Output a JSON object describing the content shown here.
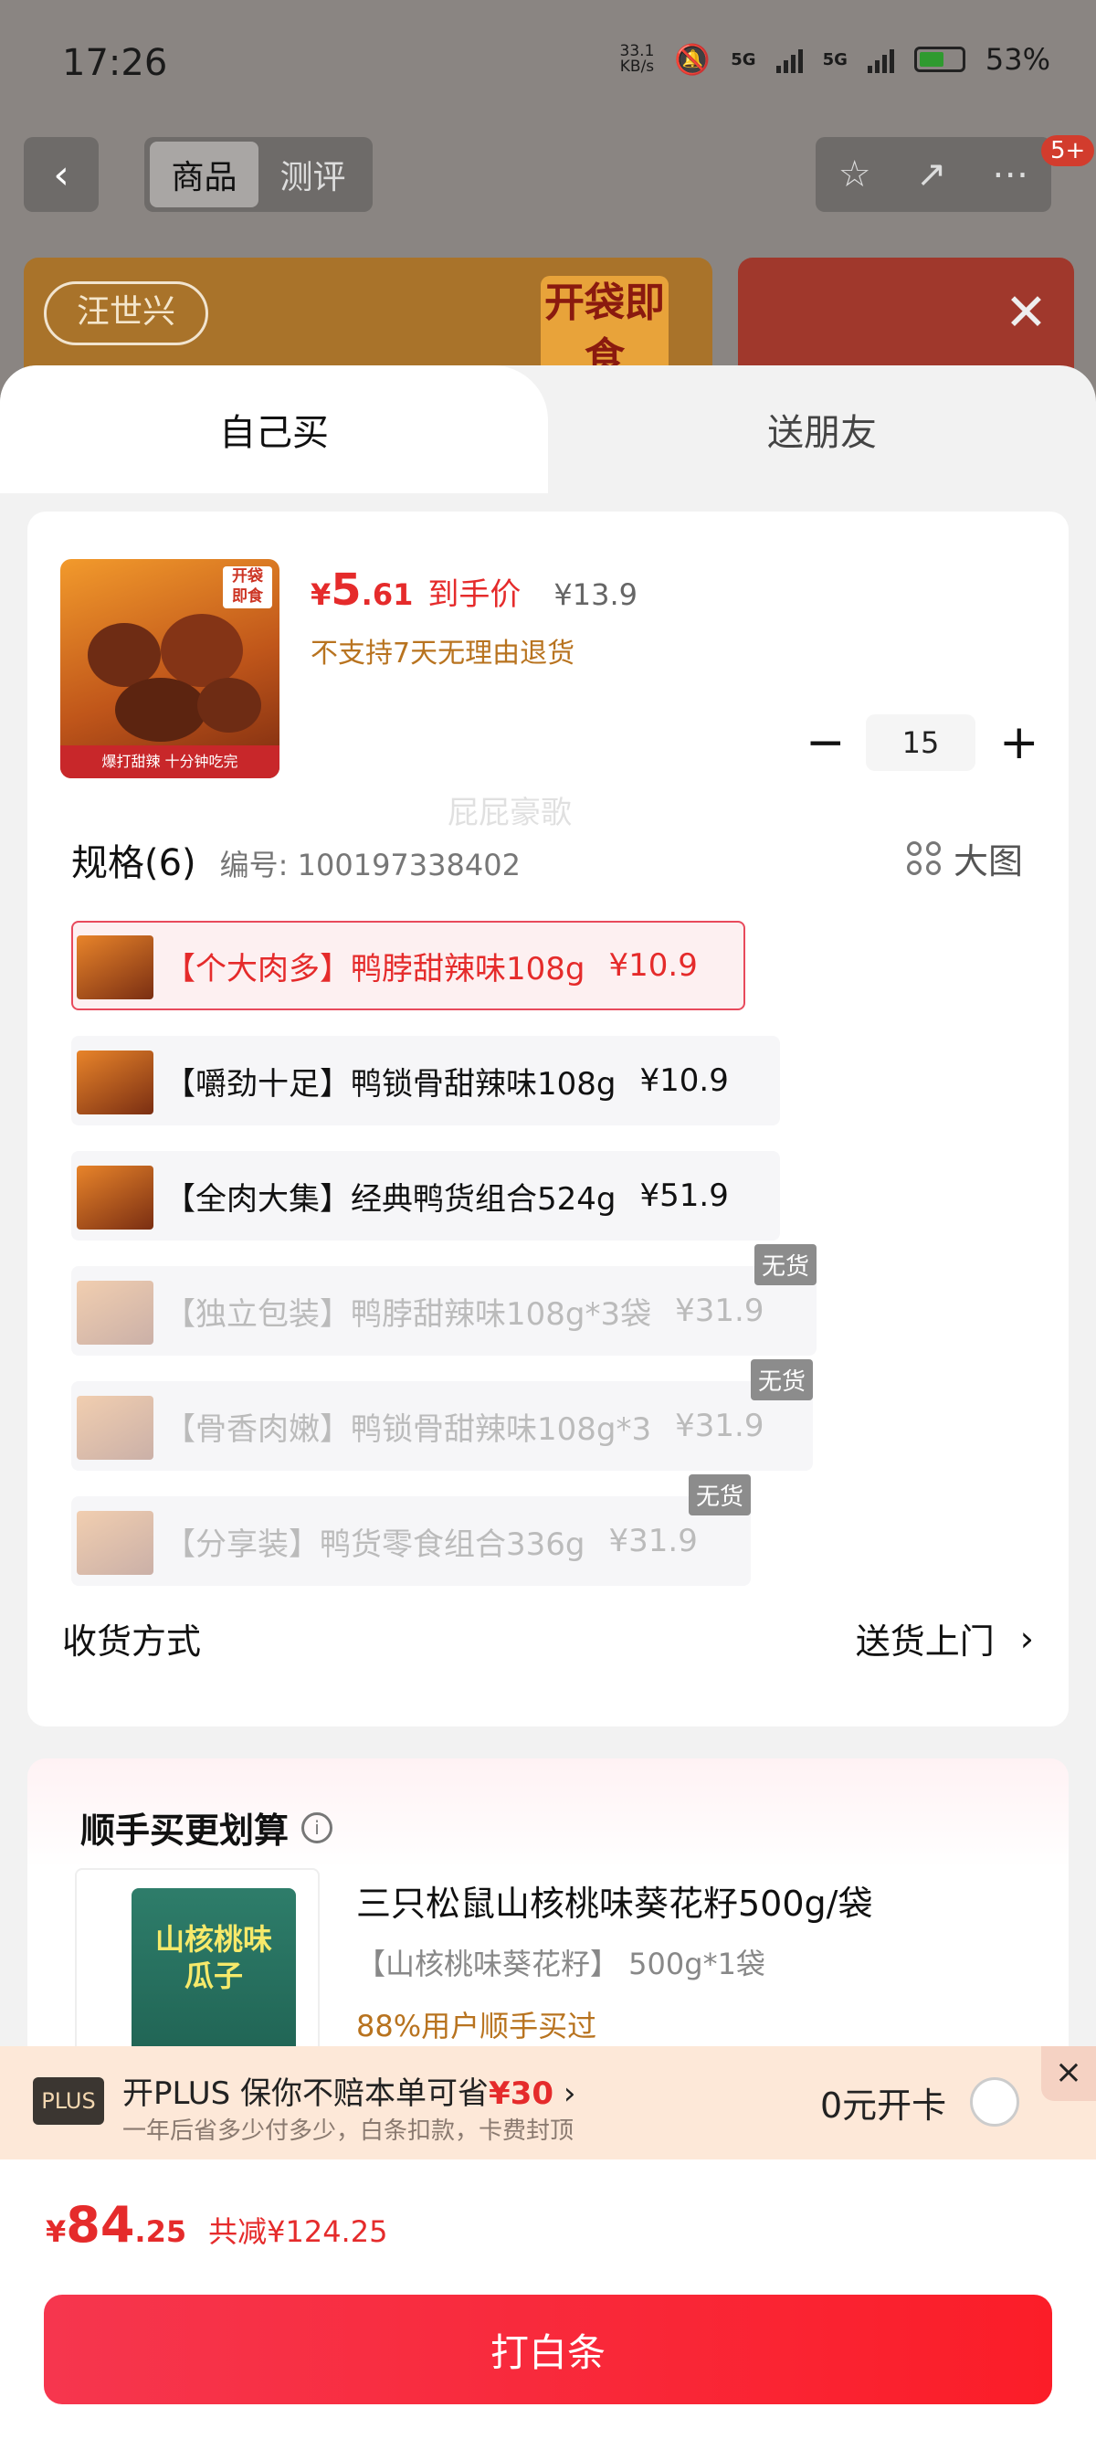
{
  "status_bar": {
    "time": "17:26",
    "net_speed": "33.1\nKB/s",
    "network1": "5G",
    "network2": "5G",
    "battery": "53%"
  },
  "nav": {
    "back": "‹",
    "tabs": [
      "商品",
      "测评"
    ],
    "badge": "5+"
  },
  "background": {
    "brand_logo": "汪世兴",
    "sticker": "开袋即食"
  },
  "sheet": {
    "tabs": [
      "自己买",
      "送朋友"
    ],
    "product": {
      "image_label": "开袋\n即食",
      "image_footer": "爆打甜辣 十分钟吃完",
      "price_symbol": "¥",
      "price_int": "5",
      "price_dec": ".61",
      "price_label": "到手价",
      "original_price": "¥13.9",
      "return_policy": "不支持7天无理由退货",
      "quantity": "15"
    },
    "spec": {
      "title": "规格(6)",
      "code": "编号: 100197338402",
      "big_image": "大图",
      "options": [
        {
          "label": "【个大肉多】鸭脖甜辣味108g",
          "price": "¥10.9",
          "state": "selected"
        },
        {
          "label": "【嚼劲十足】鸭锁骨甜辣味108g",
          "price": "¥10.9",
          "state": "normal"
        },
        {
          "label": "【全肉大集】经典鸭货组合524g",
          "price": "¥51.9",
          "state": "normal"
        },
        {
          "label": "【独立包装】鸭脖甜辣味108g*3袋",
          "price": "¥31.9",
          "state": "out",
          "tag": "无货"
        },
        {
          "label": "【骨香肉嫩】鸭锁骨甜辣味108g*3",
          "price": "¥31.9",
          "state": "out",
          "tag": "无货"
        },
        {
          "label": "【分享装】鸭货零食组合336g",
          "price": "¥31.9",
          "state": "out",
          "tag": "无货"
        }
      ]
    },
    "delivery": {
      "label": "收货方式",
      "value": "送货上门"
    },
    "recommend": {
      "title": "顺手买更划算",
      "pack_label": "山核桃味\n瓜子",
      "name": "三只松鼠山核桃味葵花籽500g/袋",
      "spec": "【山核桃味葵花籽】 500g*1袋",
      "bought": "88%用户顺手买过"
    }
  },
  "plus": {
    "badge": "PLUS",
    "title_prefix": "开PLUS 保你不赔本单可省",
    "title_amount": "¥30",
    "subtitle": "一年后省多少付多少，白条扣款，卡费封顶",
    "open_label": "0元开卡",
    "close": "×"
  },
  "footer": {
    "currency": "¥",
    "total_int": "84",
    "total_dec": ".25",
    "discount": "共减¥124.25",
    "pay_button": "打白条"
  },
  "colors": {
    "accent": "#e52b2b",
    "button": "#f6364e",
    "gold": "#b8731f"
  }
}
